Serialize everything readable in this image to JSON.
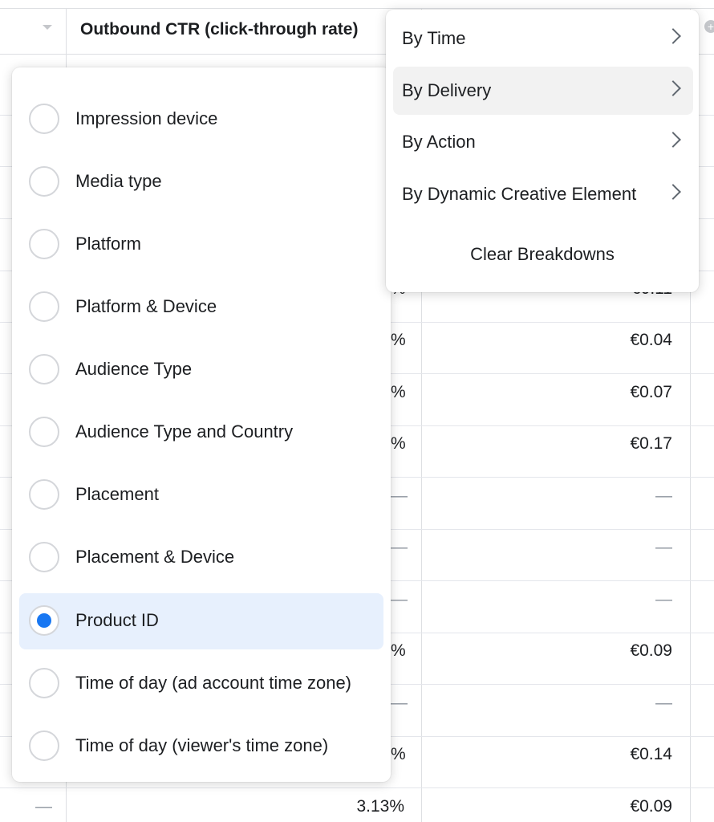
{
  "table": {
    "column_header": "Outbound CTR (click-through rate)",
    "rows": [
      {
        "pct": "%",
        "cost": "€0.11"
      },
      {
        "pct": "%",
        "cost": "€0.04"
      },
      {
        "pct": "%",
        "cost": "€0.07"
      },
      {
        "pct": "%",
        "cost": "€0.17"
      },
      {
        "pct": "—",
        "cost": "—"
      },
      {
        "pct": "—",
        "cost": "—"
      },
      {
        "pct": "—",
        "cost": "—"
      },
      {
        "pct": "%",
        "cost": "€0.09"
      },
      {
        "pct": "—",
        "cost": "—"
      },
      {
        "pct": "%",
        "cost": "€0.14"
      }
    ],
    "last_row": {
      "first": "—",
      "pct": "3.13%",
      "cost": "€0.09"
    }
  },
  "delivery_submenu": {
    "options": [
      {
        "label": "Impression device",
        "selected": false
      },
      {
        "label": "Media type",
        "selected": false
      },
      {
        "label": "Platform",
        "selected": false
      },
      {
        "label": "Platform & Device",
        "selected": false
      },
      {
        "label": "Audience Type",
        "selected": false
      },
      {
        "label": "Audience Type and Country",
        "selected": false
      },
      {
        "label": "Placement",
        "selected": false
      },
      {
        "label": "Placement & Device",
        "selected": false
      },
      {
        "label": "Product ID",
        "selected": true
      },
      {
        "label": "Time of day (ad account time zone)",
        "selected": false
      },
      {
        "label": "Time of day (viewer's time zone)",
        "selected": false
      }
    ]
  },
  "breakdown_menu": {
    "items": [
      {
        "label": "By Time"
      },
      {
        "label": "By Delivery"
      },
      {
        "label": "By Action"
      },
      {
        "label": "By Dynamic Creative Element"
      }
    ],
    "clear_label": "Clear Breakdowns"
  },
  "colors": {
    "accent": "#1877f2",
    "selected_bg": "#e7f0fd",
    "hover_bg": "#f2f2f2",
    "border": "#dddfe2"
  }
}
